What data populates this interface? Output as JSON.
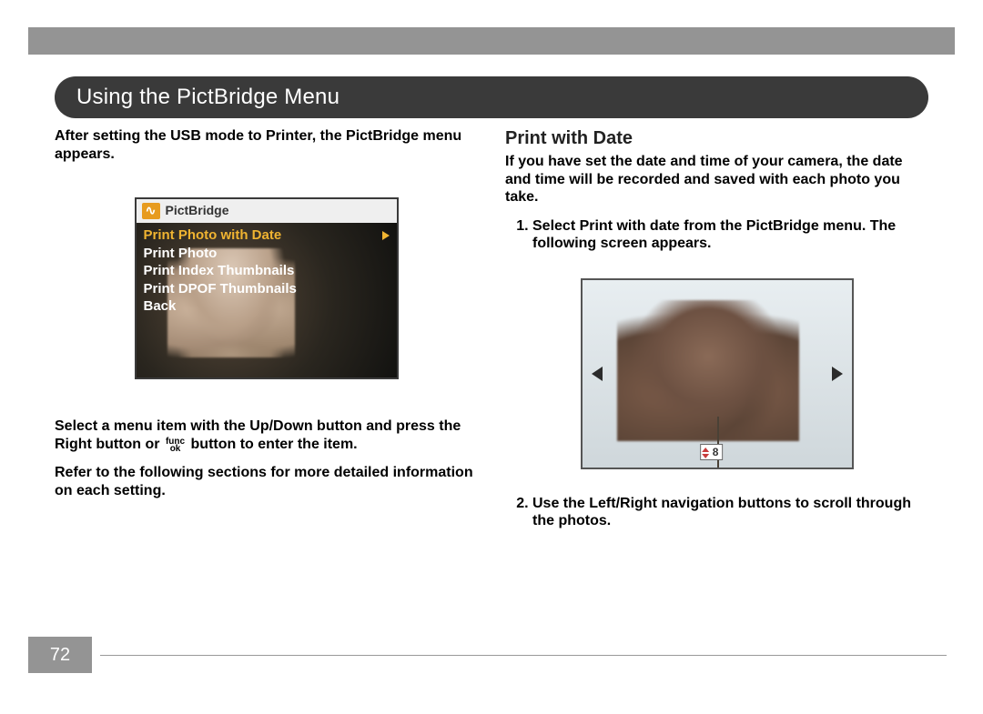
{
  "section_title": "Using the PictBridge Menu",
  "page_number": "72",
  "left": {
    "intro": "After setting the USB mode to Printer, the PictBridge menu appears.",
    "menu": {
      "header": "PictBridge",
      "items": [
        "Print Photo with Date",
        "Print Photo",
        "Print Index Thumbnails",
        "Print DPOF Thumbnails",
        "Back"
      ]
    },
    "select_text_a": "Select a menu item with the Up/Down button and press the Right button or ",
    "func_top": "func",
    "func_bot": "ok",
    "select_text_b": " button to enter the item.",
    "refer": "Refer to the following sections for more detailed information on each setting."
  },
  "right": {
    "heading": "Print with Date",
    "intro": "If you have set the date and time of your camera, the date and time will be recorded and saved with each photo you take.",
    "step1": "Select Print with date from the PictBridge menu.  The following screen appears.",
    "step2": "Use the Left/Right navigation buttons to scroll through the photos.",
    "counter": "8"
  }
}
